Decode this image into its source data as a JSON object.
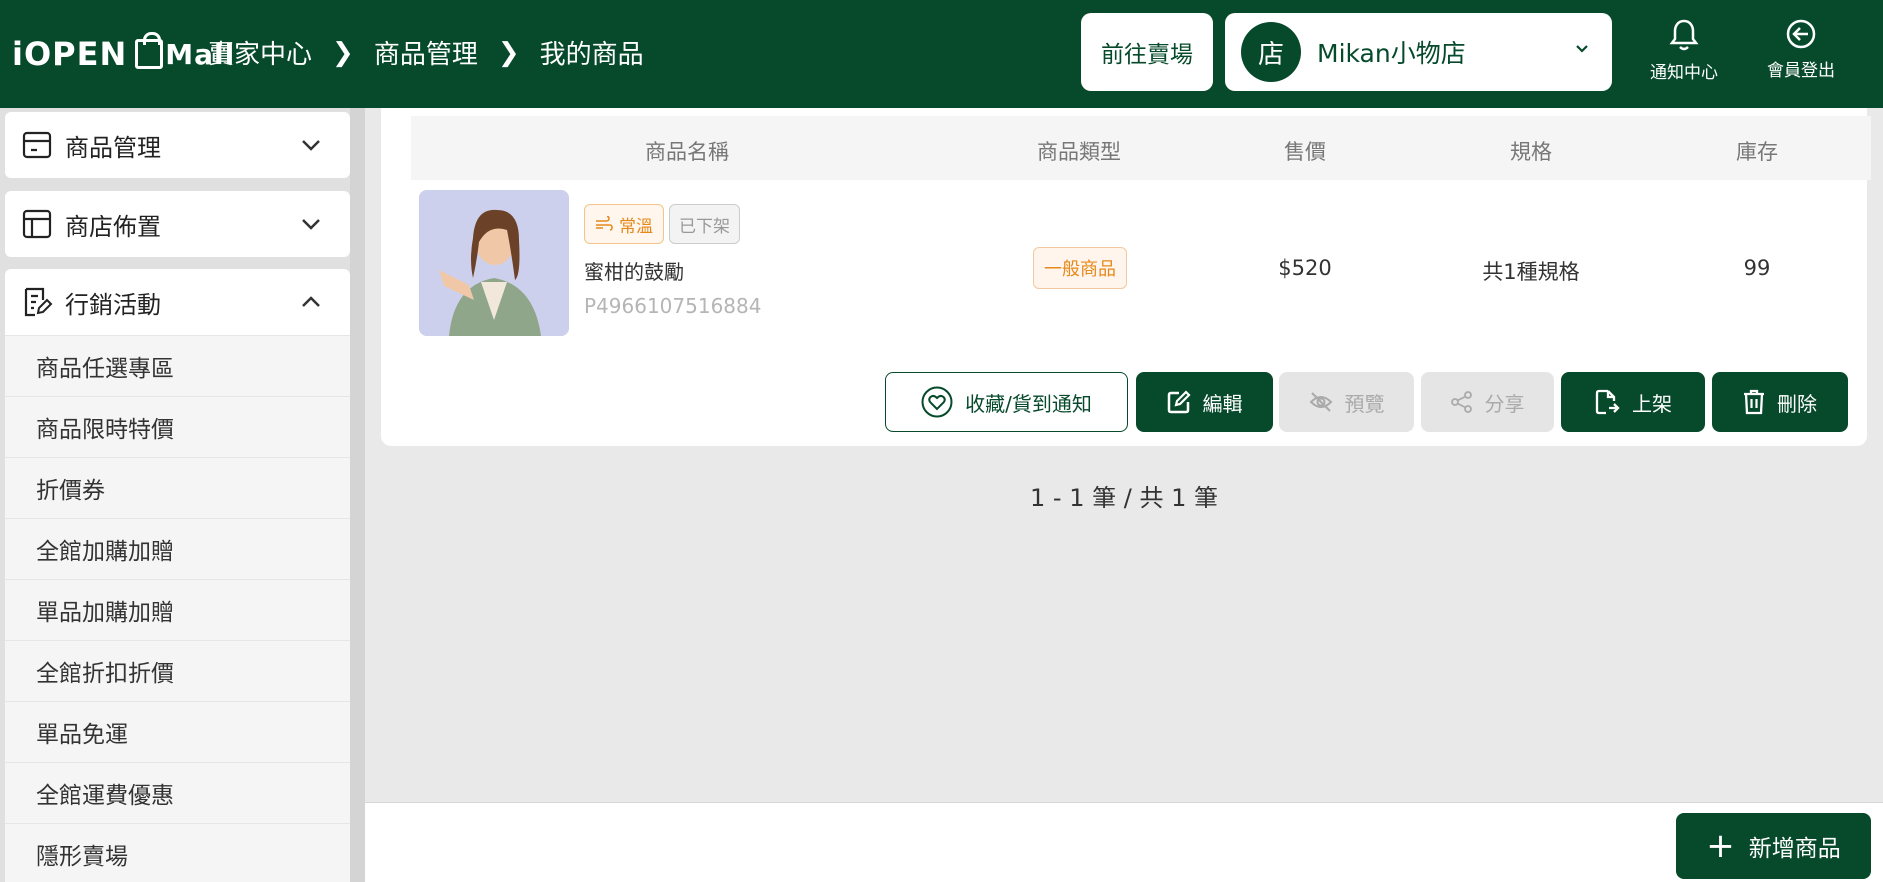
{
  "header": {
    "logo_text": "iOPEN",
    "logo_mall": "Mall",
    "breadcrumb": [
      "賣家中心",
      "商品管理",
      "我的商品"
    ],
    "goto_store_label": "前往賣場",
    "store_avatar": "店",
    "store_name": "Mikan小物店",
    "notify_label": "通知中心",
    "logout_label": "會員登出"
  },
  "sidebar": {
    "menus": [
      {
        "label": "商品管理",
        "icon": "box-icon",
        "expanded": false
      },
      {
        "label": "商店佈置",
        "icon": "layout-icon",
        "expanded": false
      },
      {
        "label": "行銷活動",
        "icon": "edit-doc-icon",
        "expanded": true
      }
    ],
    "marketing_items": [
      "商品任選專區",
      "商品限時特價",
      "折價券",
      "全館加購加贈",
      "單品加購加贈",
      "全館折扣折價",
      "單品免運",
      "全館運費優惠",
      "隱形賣場"
    ]
  },
  "table": {
    "headers": [
      "商品名稱",
      "商品類型",
      "售價",
      "規格",
      "庫存"
    ],
    "row": {
      "tag_temp": "常溫",
      "tag_status": "已下架",
      "name": "蜜柑的鼓勵",
      "code": "P4966107516884",
      "type": "一般商品",
      "price": "$520",
      "spec": "共1種規格",
      "stock": "99"
    },
    "actions": {
      "favorite": "收藏/貨到通知",
      "edit": "編輯",
      "preview": "預覽",
      "share": "分享",
      "publish": "上架",
      "delete": "刪除"
    }
  },
  "pager": "1 - 1 筆 / 共 1 筆",
  "footer": {
    "add_label": "新增商品"
  },
  "colors": {
    "brand": "#064a2b",
    "accent_orange": "#e5891d"
  }
}
